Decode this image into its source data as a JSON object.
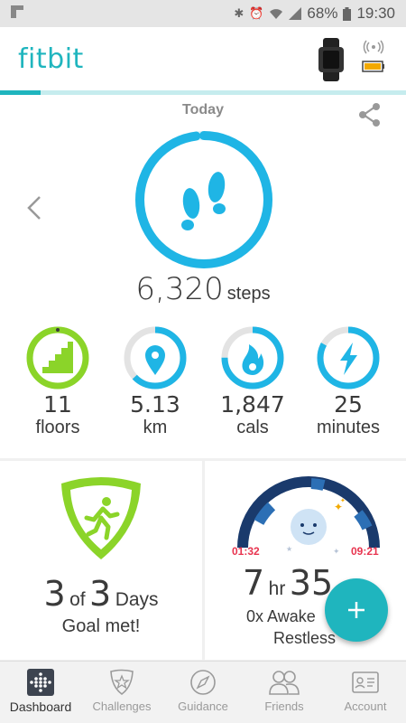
{
  "statusbar": {
    "battery": "68%",
    "time": "19:30"
  },
  "header": {
    "logo": "fitbit",
    "goal_progress": 0.1
  },
  "dashboard": {
    "date": "Today",
    "steps": {
      "value": "6,320",
      "unit": "steps",
      "progress": 0.98
    },
    "stats": [
      {
        "value": "11",
        "label": "floors",
        "progress": 1.0,
        "color": "#8bd429"
      },
      {
        "value": "5.13",
        "label": "km",
        "progress": 0.63,
        "color": "#1fb5e5"
      },
      {
        "value": "1,847",
        "label": "cals",
        "progress": 0.75,
        "color": "#1fb5e5"
      },
      {
        "value": "25",
        "label": "minutes",
        "progress": 0.83,
        "color": "#1fb5e5"
      }
    ]
  },
  "goal": {
    "count": "3",
    "of_word": "of",
    "total": "3",
    "unit": "Days",
    "caption": "Goal met!"
  },
  "sleep": {
    "start": "01:32",
    "end": "09:21",
    "hours": "7",
    "hours_unit": "hr",
    "minutes": "35",
    "awake": "0x Awake",
    "restless": "Restless"
  },
  "fab": {
    "label": "+"
  },
  "nav": [
    {
      "label": "Dashboard",
      "icon": "dashboard-icon",
      "active": true
    },
    {
      "label": "Challenges",
      "icon": "challenges-icon",
      "active": false
    },
    {
      "label": "Guidance",
      "icon": "compass-icon",
      "active": false
    },
    {
      "label": "Friends",
      "icon": "friends-icon",
      "active": false
    },
    {
      "label": "Account",
      "icon": "account-icon",
      "active": false
    }
  ],
  "colors": {
    "brand": "#1fb5be",
    "steps": "#1fb5e5",
    "floors": "#8bd429",
    "sleep": "#1a3a6c",
    "sleep_time": "#e8344f"
  }
}
